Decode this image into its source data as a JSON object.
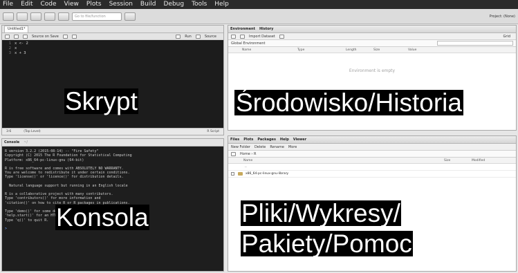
{
  "menu": [
    "File",
    "Edit",
    "Code",
    "View",
    "Plots",
    "Session",
    "Build",
    "Debug",
    "Tools",
    "Help"
  ],
  "toolbar": {
    "goto_placeholder": "Go to file/function",
    "project": "Project: (None)"
  },
  "editor": {
    "tab": "Untitled1*",
    "source_on_save": "Source on Save",
    "run": "Run",
    "source": "Source",
    "lines": [
      {
        "n": "1",
        "code": "x <- 2"
      },
      {
        "n": "2",
        "code": "x"
      },
      {
        "n": "3",
        "code": "x + 3"
      }
    ],
    "status_pos": "3:6",
    "status_level": "(Top Level)",
    "status_type": "R Script"
  },
  "console": {
    "tab": "Console",
    "path": "~/",
    "lines": [
      "R version 3.2.2 (2015-08-14) -- \"Fire Safety\"",
      "Copyright (C) 2015 The R Foundation for Statistical Computing",
      "Platform: x86_64-pc-linux-gnu (64-bit)",
      "",
      "R is free software and comes with ABSOLUTELY NO WARRANTY.",
      "You are welcome to redistribute it under certain conditions.",
      "Type 'license()' or 'licence()' for distribution details.",
      "",
      "  Natural language support but running in an English locale",
      "",
      "R is a collaborative project with many contributors.",
      "Type 'contributors()' for more information and",
      "'citation()' on how to cite R or R packages in publications.",
      "",
      "Type 'demo()' for some demos, 'help()' for on-line help, or",
      "'help.start()' for an HTML browser interface to help.",
      "Type 'q()' to quit R.",
      ""
    ],
    "prompt": ">"
  },
  "environment": {
    "tabs": [
      "Environment",
      "History"
    ],
    "import": "Import Dataset",
    "scope": "Global Environment",
    "grid": "Grid",
    "columns": [
      "Name",
      "Type",
      "Length",
      "Size",
      "Value"
    ],
    "empty_message": "Environment is empty"
  },
  "files": {
    "tabs": [
      "Files",
      "Plots",
      "Packages",
      "Help",
      "Viewer"
    ],
    "actions": [
      "New Folder",
      "Delete",
      "Rename",
      "More"
    ],
    "breadcrumb": "Home › R",
    "columns": [
      "Name",
      "Size",
      "Modified"
    ],
    "rows": [
      "..",
      "x86_64-pc-linux-gnu-library"
    ]
  },
  "overlays": {
    "skrypt": "Skrypt",
    "srodowisko": "Środowisko/Historia",
    "konsola": "Konsola",
    "pliki_line1": "Pliki/Wykresy/",
    "pliki_line2": "Pakiety/Pomoc"
  }
}
